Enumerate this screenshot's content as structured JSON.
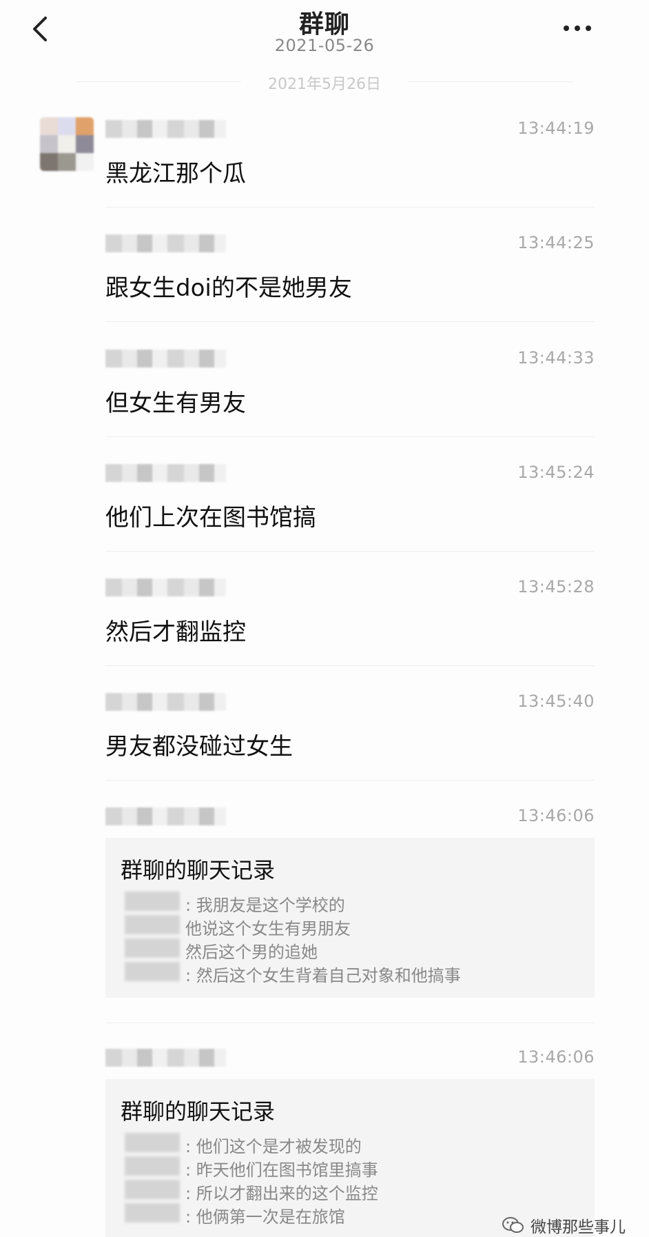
{
  "header": {
    "title": "群聊",
    "subtitle": "2021-05-26",
    "back_icon": "chevron-left-icon",
    "more_icon": "more-horizontal-icon"
  },
  "date_divider": "2021年5月26日",
  "messages": [
    {
      "time": "13:44:19",
      "text": "黑龙江那个瓜"
    },
    {
      "time": "13:44:25",
      "text": "跟女生doi的不是她男友"
    },
    {
      "time": "13:44:33",
      "text": "但女生有男友"
    },
    {
      "time": "13:45:24",
      "text": "他们上次在图书馆搞"
    },
    {
      "time": "13:45:28",
      "text": "然后才翻监控"
    },
    {
      "time": "13:45:40",
      "text": "男友都没碰过女生"
    }
  ],
  "records": [
    {
      "time": "13:46:06",
      "title": "群聊的聊天记录",
      "lines": [
        ": 我朋友是这个学校的",
        "他说这个女生有男朋友",
        "然后这个男的追她",
        ": 然后这个女生背着自己对象和他搞事"
      ]
    },
    {
      "time": "13:46:06",
      "title": "群聊的聊天记录",
      "lines": [
        ": 他们这个是才被发现的",
        ": 昨天他们在图书馆里搞事",
        ": 所以才翻出来的这个监控",
        ": 他俩第一次是在旅馆"
      ]
    }
  ],
  "watermark": {
    "icon": "wechat-icon",
    "text": "微博那些事儿"
  }
}
